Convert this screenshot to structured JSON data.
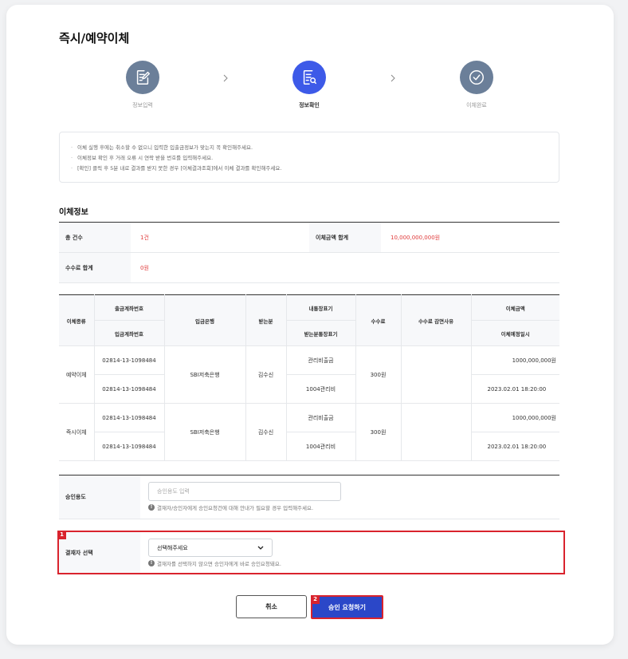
{
  "page": {
    "title": "즉시/예약이체"
  },
  "steps": [
    {
      "label": "정보입력",
      "icon": "edit-document-icon",
      "state": "done"
    },
    {
      "label": "정보확인",
      "icon": "document-search-icon",
      "state": "current"
    },
    {
      "label": "이체완료",
      "icon": "check-circle-icon",
      "state": "pending"
    }
  ],
  "notice": {
    "items": [
      "이체 실행 후에는 취소할 수 없으니 입력한 입출금정보가 맞는지 꼭 확인해주세요.",
      "이체정보 확인 후 거래 오류 시 연락 받을 번호를 입력해주세요.",
      "[확인] 클릭 후 5분 내로 결과를 받지 못한 경우 [이체결과조회]에서 이체 결과를 확인해주세요."
    ]
  },
  "transfer_info": {
    "section_title": "이체정보",
    "total_count_label": "총 건수",
    "total_count_value": "1건",
    "total_amount_label": "이체금액 합계",
    "total_amount_value": "10,000,000,000원",
    "fee_total_label": "수수료 합계",
    "fee_total_value": "0원"
  },
  "detail_table": {
    "headers": {
      "type": "이체종류",
      "out_account": "출금계좌번호",
      "in_account": "입금계좌번호",
      "in_bank": "입금은행",
      "recipient": "받는분",
      "my_memo": "내통장표기",
      "their_memo": "받는분통장표기",
      "fee": "수수료",
      "fee_reason": "수수료 감면사유",
      "amount": "이체금액",
      "schedule": "이체예정일시"
    },
    "rows": [
      {
        "type": "예약이체",
        "out_account": "02814-13-1098484",
        "in_account": "02814-13-1098484",
        "in_bank": "SBI저축은행",
        "recipient": "김수신",
        "my_memo": "관리비출금",
        "their_memo": "1004관리비",
        "fee": "300원",
        "fee_reason": "",
        "amount": "1000,000,000원",
        "schedule": "2023.02.01 18:20:00"
      },
      {
        "type": "즉시이체",
        "out_account": "02814-13-1098484",
        "in_account": "02814-13-1098484",
        "in_bank": "SBI저축은행",
        "recipient": "김수신",
        "my_memo": "관리비출금",
        "their_memo": "1004관리비",
        "fee": "300원",
        "fee_reason": "",
        "amount": "1000,000,000원",
        "schedule": "2023.02.01 18:20:00"
      }
    ]
  },
  "approval": {
    "purpose_label": "승인용도",
    "purpose_placeholder": "승인용도 입력",
    "purpose_hint": "결재자/승인자에게 승인요청건에 대해 안내가 필요할 경우 입력해주세요.",
    "approver_label": "결재자 선택",
    "approver_selected": "선택해주세요",
    "approver_hint": "결재자를 선택하지 않으면 승인자에게 바로 승인요청돼요."
  },
  "annotations": {
    "badge1": "1",
    "badge2": "2"
  },
  "actions": {
    "cancel_label": "취소",
    "request_label": "승인 요청하기"
  },
  "colors": {
    "accent_blue": "#2b47c8",
    "step_done": "#6b7f99",
    "step_current": "#3d5ae8",
    "highlight_red": "#d9232d",
    "amount_red": "#e03a3a"
  }
}
